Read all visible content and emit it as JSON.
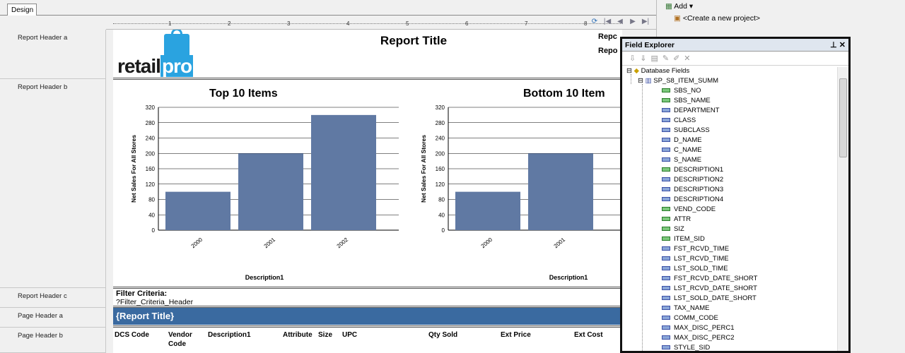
{
  "tabs": {
    "design": "Design"
  },
  "ruler": {
    "numbers": [
      "1",
      "2",
      "3",
      "4",
      "5",
      "6",
      "7",
      "8"
    ]
  },
  "nav": {
    "refresh_icon": "refresh-icon",
    "controls": [
      "|◀",
      "◀",
      "▶",
      "▶|"
    ]
  },
  "bands": [
    "Report Header a",
    "Report Header b",
    "Report Header c",
    "Page Header a",
    "Page Header b"
  ],
  "header": {
    "logo_text_a": "retail",
    "logo_text_b": "pro",
    "report_title": "Report Title",
    "right_cut_1": "Repc",
    "right_cut_2": "Repo"
  },
  "charts": [
    {
      "title": "Top 10 Items"
    },
    {
      "title": "Bottom 10 Item"
    }
  ],
  "chart_data": [
    {
      "type": "bar",
      "title": "Top 10 Items",
      "xlabel": "Description1",
      "ylabel": "Net Sales For All Stores",
      "categories": [
        "2000",
        "2001",
        "2002"
      ],
      "values": [
        100,
        200,
        300
      ],
      "ylim": [
        0,
        320
      ],
      "yticks": [
        0,
        40,
        80,
        120,
        160,
        200,
        240,
        280,
        320
      ],
      "color": "#6079a3",
      "grid": true
    },
    {
      "type": "bar",
      "title": "Bottom 10 Item",
      "xlabel": "Description1",
      "ylabel": "Net Sales For All Stores",
      "categories": [
        "2000",
        "2001"
      ],
      "values": [
        100,
        200
      ],
      "ylim": [
        0,
        320
      ],
      "yticks": [
        0,
        40,
        80,
        120,
        160,
        200,
        240,
        280,
        320
      ],
      "color": "#6079a3",
      "grid": true
    }
  ],
  "filter": {
    "label": "Filter Criteria:",
    "value": "?Filter_Criteria_Header"
  },
  "page_title": "{Report Title}",
  "columns": [
    {
      "label": "DCS Code"
    },
    {
      "label": "Vendor",
      "label2": "Code"
    },
    {
      "label": "Description1"
    },
    {
      "label": "Attribute"
    },
    {
      "label": "Size"
    },
    {
      "label": "UPC"
    },
    {
      "label": "Qty Sold"
    },
    {
      "label": "Ext Price"
    },
    {
      "label": "Ext Cost"
    }
  ],
  "right_pane": {
    "add_label": "Add",
    "create_project": "<Create a new project>"
  },
  "field_explorer": {
    "title": "Field Explorer",
    "root": "Database Fields",
    "table": "SP_S8_ITEM_SUMM",
    "fields": [
      {
        "name": "SBS_NO",
        "checked": true
      },
      {
        "name": "SBS_NAME",
        "checked": true
      },
      {
        "name": "DEPARTMENT",
        "checked": false
      },
      {
        "name": "CLASS",
        "checked": false
      },
      {
        "name": "SUBCLASS",
        "checked": false
      },
      {
        "name": "D_NAME",
        "checked": false
      },
      {
        "name": "C_NAME",
        "checked": false
      },
      {
        "name": "S_NAME",
        "checked": false
      },
      {
        "name": "DESCRIPTION1",
        "checked": true
      },
      {
        "name": "DESCRIPTION2",
        "checked": false
      },
      {
        "name": "DESCRIPTION3",
        "checked": false
      },
      {
        "name": "DESCRIPTION4",
        "checked": false
      },
      {
        "name": "VEND_CODE",
        "checked": true
      },
      {
        "name": "ATTR",
        "checked": true
      },
      {
        "name": "SIZ",
        "checked": true
      },
      {
        "name": "ITEM_SID",
        "checked": true
      },
      {
        "name": "FST_RCVD_TIME",
        "checked": false
      },
      {
        "name": "LST_RCVD_TIME",
        "checked": false
      },
      {
        "name": "LST_SOLD_TIME",
        "checked": false
      },
      {
        "name": "FST_RCVD_DATE_SHORT",
        "checked": false
      },
      {
        "name": "LST_RCVD_DATE_SHORT",
        "checked": false
      },
      {
        "name": "LST_SOLD_DATE_SHORT",
        "checked": false
      },
      {
        "name": "TAX_NAME",
        "checked": false
      },
      {
        "name": "COMM_CODE",
        "checked": false
      },
      {
        "name": "MAX_DISC_PERC1",
        "checked": false
      },
      {
        "name": "MAX_DISC_PERC2",
        "checked": false
      },
      {
        "name": "STYLE_SID",
        "checked": false
      }
    ]
  }
}
